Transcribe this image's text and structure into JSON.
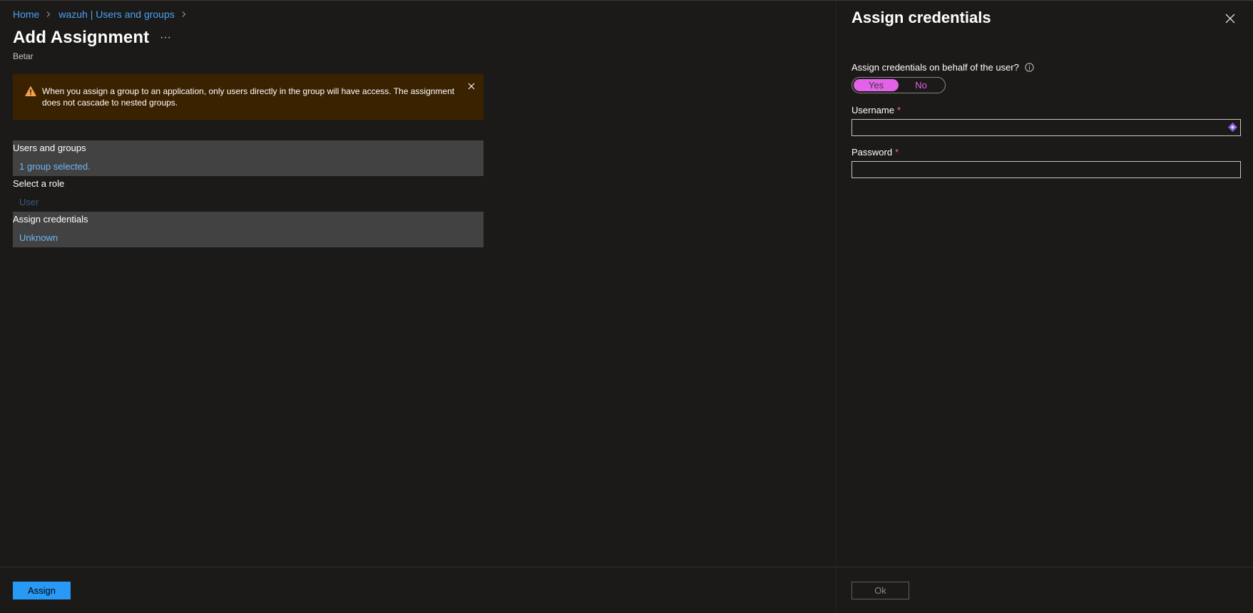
{
  "breadcrumb": {
    "home": "Home",
    "app": "wazuh | Users and groups"
  },
  "page": {
    "title": "Add Assignment",
    "more_label": "···",
    "subtitle": "Betar"
  },
  "warning": {
    "text": "When you assign a group to an application, only users directly in the group will have access. The assignment does not cascade to nested groups."
  },
  "fields": {
    "users_groups_label": "Users and groups",
    "users_groups_value": "1 group selected.",
    "role_label": "Select a role",
    "role_value": "User",
    "credentials_label": "Assign credentials",
    "credentials_value": "Unknown"
  },
  "footer": {
    "assign_label": "Assign"
  },
  "blade": {
    "title": "Assign credentials",
    "question": "Assign credentials on behalf of the user?",
    "toggle_yes": "Yes",
    "toggle_no": "No",
    "username_label": "Username",
    "username_value": "",
    "password_label": "Password",
    "password_value": "",
    "required_mark": "*",
    "ok_label": "Ok"
  },
  "colors": {
    "accent_blue": "#2899f5",
    "link_blue": "#4aa0f0",
    "toggle_pink": "#e362e9",
    "warning_bg": "#3a2200",
    "warning_icon": "#f7a24a",
    "required_red": "#f1707b"
  }
}
